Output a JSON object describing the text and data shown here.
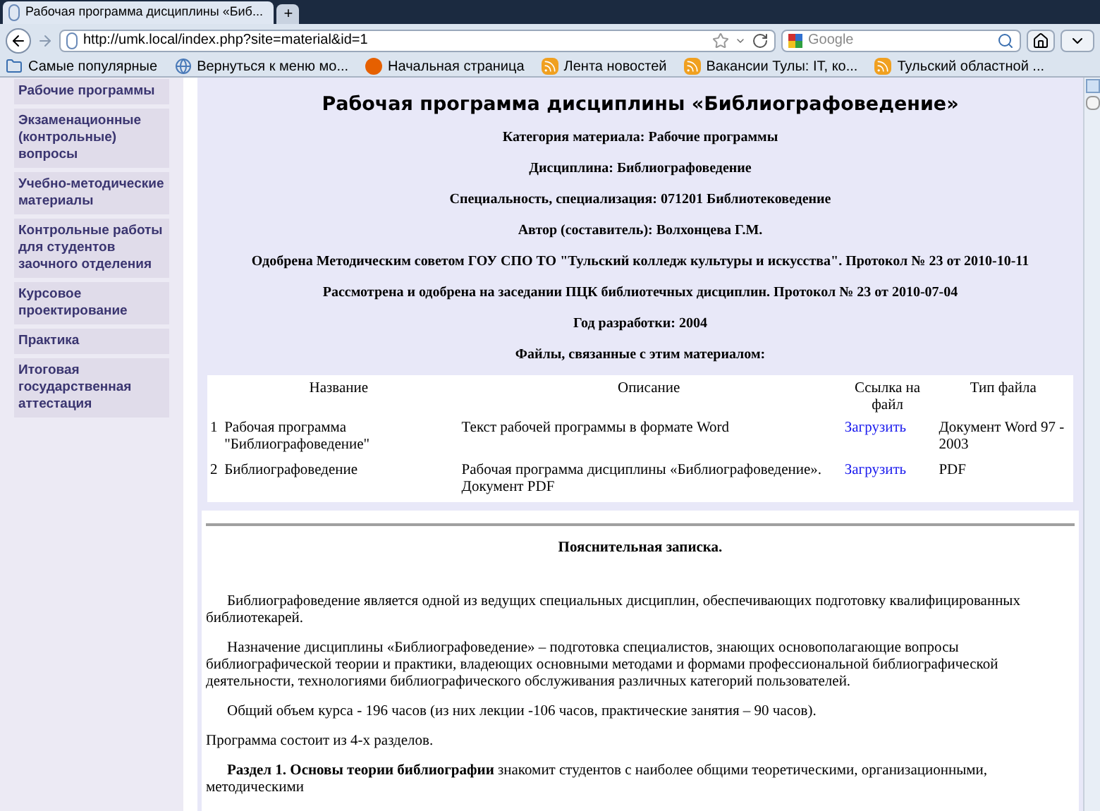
{
  "browser": {
    "tabs": [
      {
        "title": "Рабочая программа дисциплины «Биб...",
        "selected": true
      }
    ],
    "new_tab": "+",
    "url": "http://umk.local/index.php?site=material&id=1",
    "search": {
      "placeholder": "Google"
    },
    "bookmarks": [
      {
        "label": "Самые популярные",
        "kind": "popular"
      },
      {
        "label": "Вернуться к меню мо...",
        "kind": "back"
      },
      {
        "label": "Начальная страница",
        "kind": "firefox"
      },
      {
        "label": "Лента новостей",
        "kind": "feed"
      },
      {
        "label": "Вакансии Тулы: IT, ко...",
        "kind": "feed"
      },
      {
        "label": "Тульский областной ...",
        "kind": "feed"
      }
    ]
  },
  "sidebar": {
    "items": [
      {
        "label": "Рабочие программы"
      },
      {
        "label": "Экзаменационные (контрольные) вопросы"
      },
      {
        "label": "Учебно-методические материалы"
      },
      {
        "label": "Контрольные работы для студентов заочного отделения"
      },
      {
        "label": "Курсовое проектирование"
      },
      {
        "label": "Практика"
      },
      {
        "label": "Итоговая государственная аттестация"
      }
    ]
  },
  "page": {
    "title": "Рабочая программа дисциплины «Библиографоведение»",
    "meta": [
      "Категория материала: Рабочие программы",
      "Дисциплина: Библиографоведение",
      "Специальность, специализация: 071201 Библиотековедение",
      "Автор (составитель): Волхонцева Г.М.",
      "Одобрена Методическим советом ГОУ СПО ТО \"Тульский колледж культуры и искусства\". Протокол № 23 от 2010-10-11",
      "Рассмотрена и одобрена на заседании ПЦК библиотечных дисциплин. Протокол № 23 от 2010-07-04",
      "Год разработки: 2004",
      "Файлы, связанные с этим материалом:"
    ],
    "files_table": {
      "columns": [
        "Название",
        "Описание",
        "Ссылка на файл",
        "Тип файла"
      ],
      "rows": [
        {
          "number": "1",
          "name": "Рабочая программа \"Библиографоведение\"",
          "description": "Текст рабочей программы в формате Word",
          "link": "Загрузить",
          "type": "Документ Word 97 - 2003"
        },
        {
          "number": "2",
          "name": "Библиографоведение",
          "description": "Рабочая программа дисциплины «Библиографоведение». Документ PDF",
          "link": "Загрузить",
          "type": "PDF"
        }
      ]
    },
    "document": {
      "heading": "Пояснительная записка.",
      "paragraphs": [
        {
          "text": "Библиографоведение является одной из ведущих специальных дисциплин, обеспечивающих подготовку квалифицированных библиотекарей.",
          "indent": true
        },
        {
          "text": "Назначение дисциплины  «Библиографоведение» – подготовка специалистов, знающих основополагающие вопросы библиографической теории и практики, владеющих основными методами и формами профессиональной библиографической деятельности, технологиями библиографического обслуживания различных категорий пользователей.",
          "indent": true
        },
        {
          "text": "Общий объем курса - 196 часов (из них лекции -106 часов, практические занятия – 90 часов).",
          "indent": true
        },
        {
          "text": "Программа состоит из 4-х разделов.",
          "indent": false
        },
        {
          "text": "**Раздел 1. Основы теории библиографии** знакомит студентов с наиболее общими теоретическими, организационными, методическими",
          "indent": true
        }
      ]
    }
  }
}
